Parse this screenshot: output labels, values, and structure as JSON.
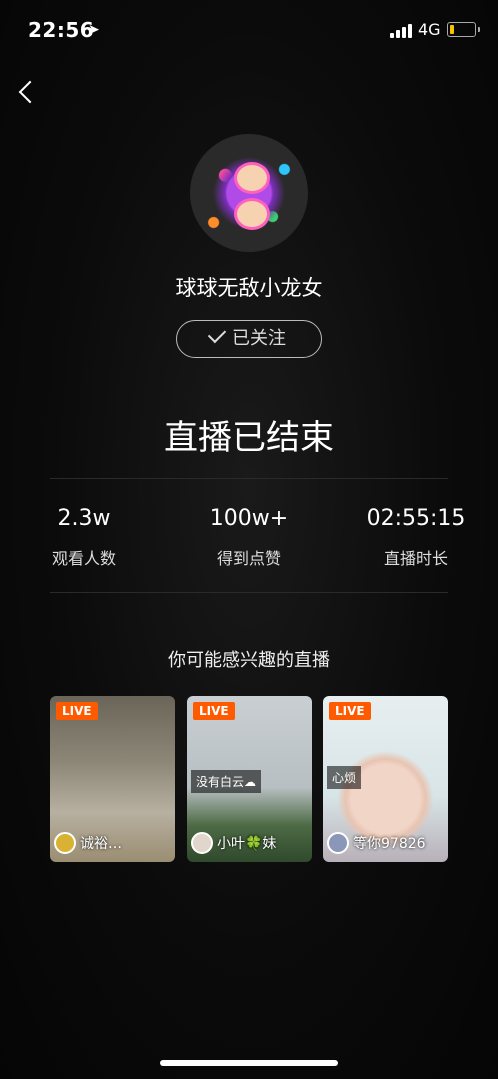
{
  "status": {
    "time": "22:56",
    "location_icon": "location-arrow-icon",
    "network": "4G"
  },
  "nav": {
    "back_icon": "chevron-left-icon"
  },
  "profile": {
    "name": "球球无敌小龙女",
    "follow_label": "已关注"
  },
  "title": "直播已结束",
  "stats": [
    {
      "value": "2.3w",
      "label": "观看人数"
    },
    {
      "value": "100w+",
      "label": "得到点赞"
    },
    {
      "value": "02:55:15",
      "label": "直播时长"
    }
  ],
  "recommend": {
    "title": "你可能感兴趣的直播",
    "cards": [
      {
        "badge": "LIVE",
        "tag": "",
        "owner": "诚裕…"
      },
      {
        "badge": "LIVE",
        "tag": "没有白云☁",
        "owner": "小叶🍀妹"
      },
      {
        "badge": "LIVE",
        "tag": "心烦",
        "owner": "等你97826"
      }
    ]
  },
  "colors": {
    "live_badge": "#ff5a00",
    "battery": "#f5c400"
  }
}
